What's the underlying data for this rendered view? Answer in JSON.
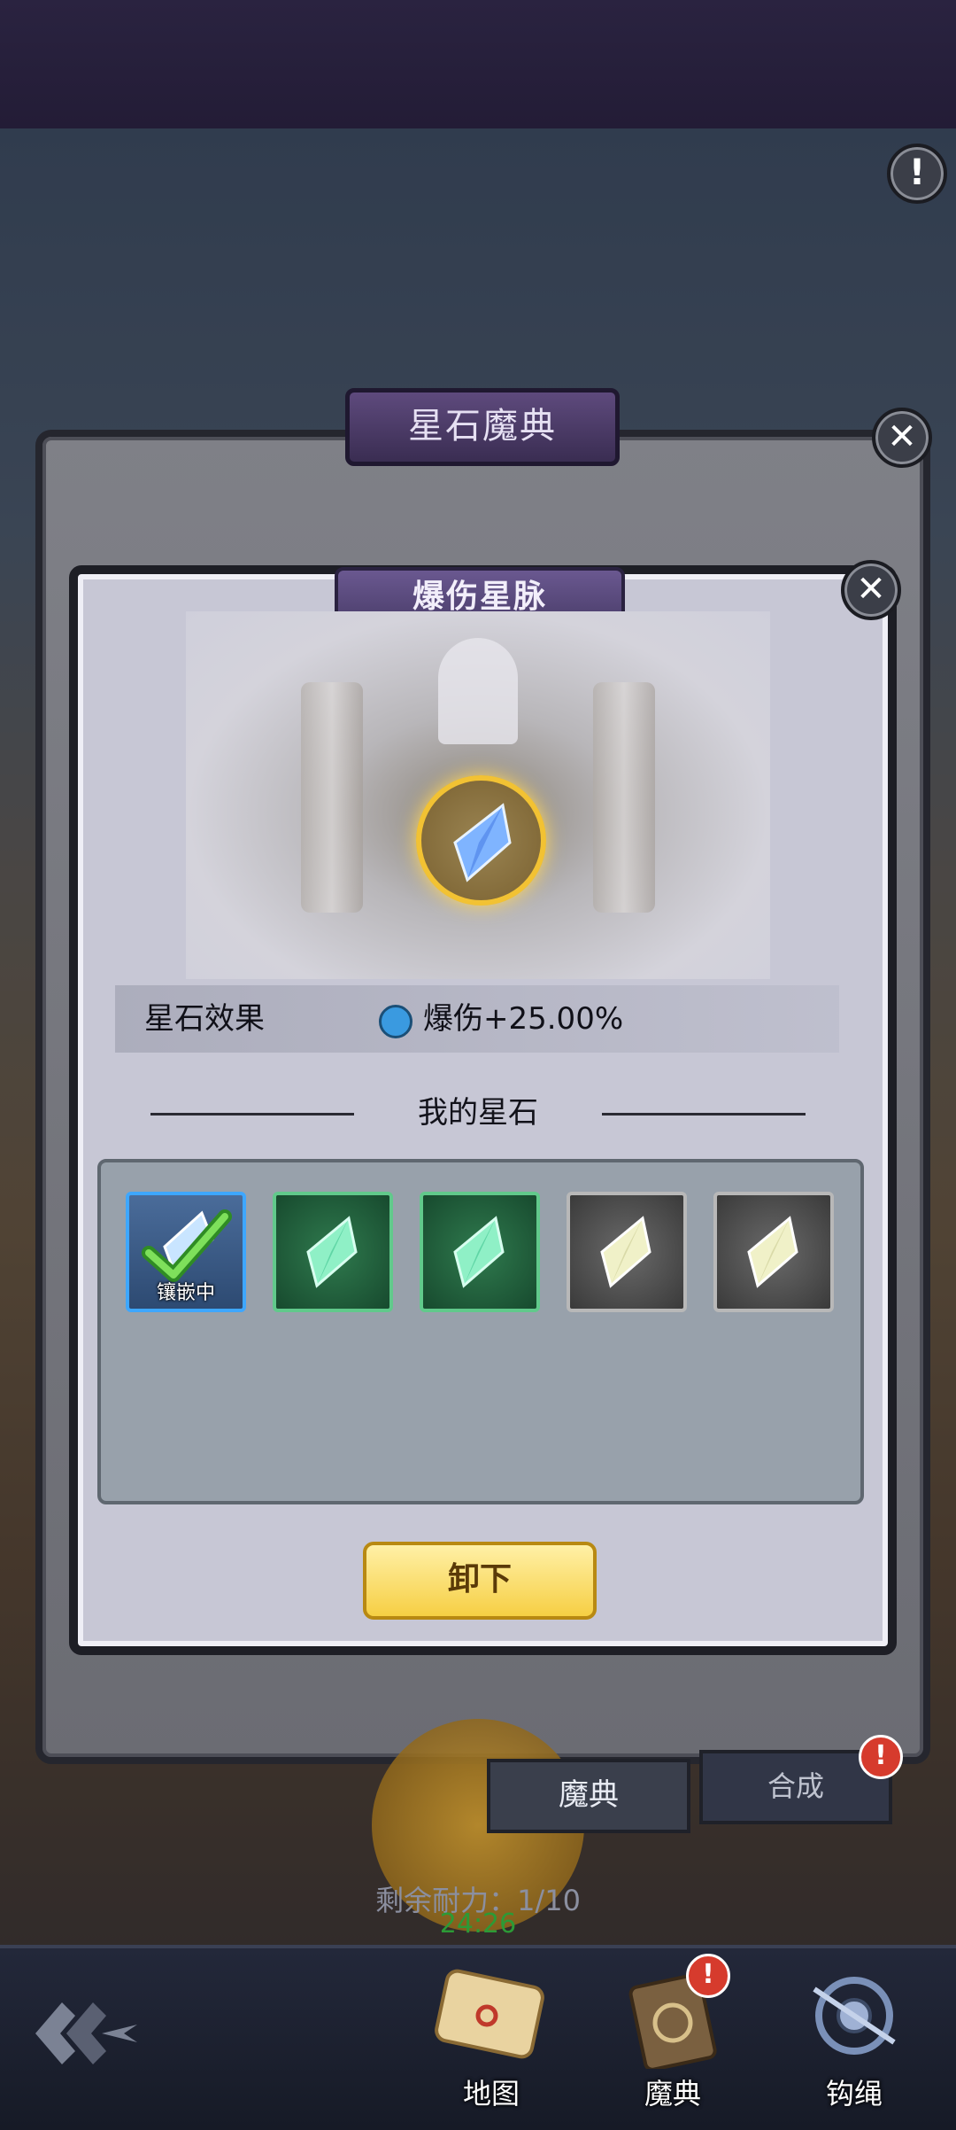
{
  "outer_panel": {
    "title": "星石魔典"
  },
  "modal": {
    "title": "爆伤星脉",
    "effect_label": "星石效果",
    "effect_value": "爆伤+25.00%",
    "my_stones_title": "我的星石",
    "slots": [
      {
        "kind": "equipped",
        "status": "镶嵌中",
        "color": "#3ea7ff"
      },
      {
        "kind": "green",
        "status": "",
        "color": "#61c98b"
      },
      {
        "kind": "green",
        "status": "",
        "color": "#61c98b"
      },
      {
        "kind": "gray",
        "status": "",
        "color": "#b8b8b8"
      },
      {
        "kind": "gray",
        "status": "",
        "color": "#b8b8b8"
      }
    ],
    "unequip_label": "卸下"
  },
  "behind": {
    "tab_magic": "魔典",
    "tab_merge": "合成",
    "merge_alert": "!",
    "stamina": "剩余耐力：1/10",
    "timer": "24:26"
  },
  "top": {
    "alert_icon": "!"
  },
  "bottom_nav": {
    "items": [
      {
        "label": "地图",
        "icon": "map-icon"
      },
      {
        "label": "魔典",
        "icon": "book-icon",
        "alert": "!"
      },
      {
        "label": "钩绳",
        "icon": "grapple-icon"
      }
    ]
  },
  "colors": {
    "accent_gold": "#f6cf44",
    "badge_red": "#d63b2d",
    "effect_dot": "#3a9ae0"
  }
}
